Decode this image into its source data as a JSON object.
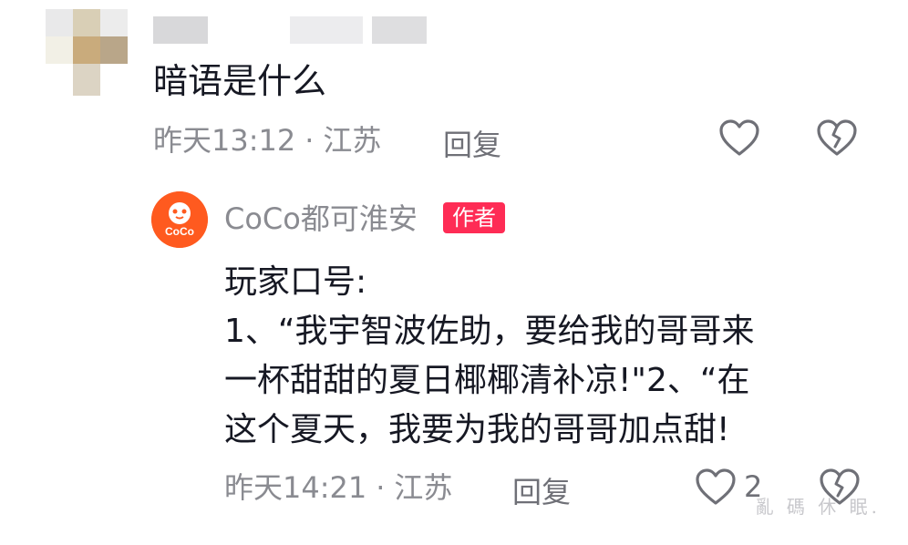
{
  "comment": {
    "text": "暗语是什么",
    "time": "昨天13:12",
    "location": "江苏",
    "reply_label": "回复"
  },
  "reply": {
    "avatar_text": "CoCo",
    "author_name": "CoCo都可淮安",
    "author_badge": "作者",
    "lines": [
      "玩家口号:",
      "1、“我宇智波佐助，要给我的哥哥来",
      "一杯甜甜的夏日椰椰清补凉!\"2、“在",
      "这个夏天，我要为我的哥哥加点甜!"
    ],
    "time": "昨天14:21",
    "location": "江苏",
    "reply_label": "回复",
    "like_count": "2"
  },
  "watermark": "亂 碼 休 眠.",
  "icons": {
    "like": "heart-outline-icon",
    "dislike": "broken-heart-icon"
  },
  "colors": {
    "badge": "#fe2c55",
    "avatar": "#ff5a1f",
    "meta_text": "#8a8b91"
  }
}
